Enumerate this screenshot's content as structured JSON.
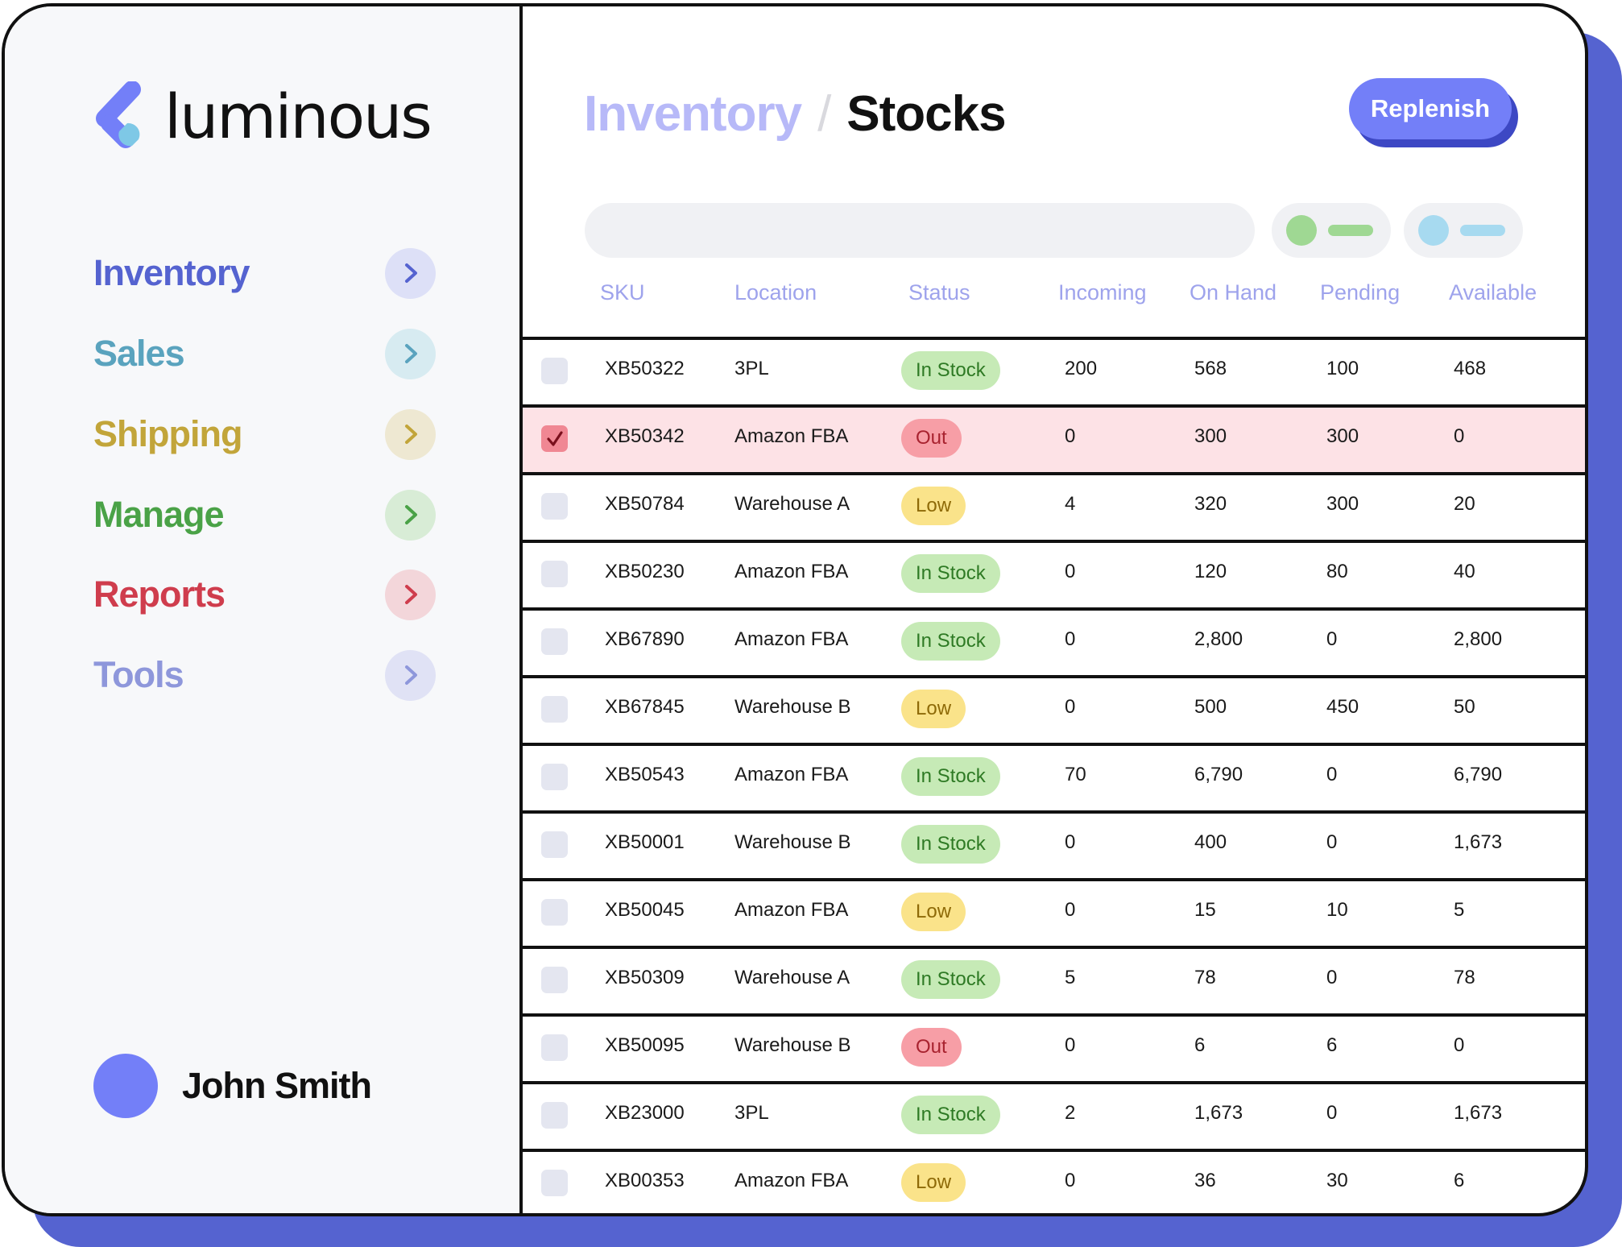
{
  "brand": {
    "name": "luminous"
  },
  "sidebar": {
    "items": [
      {
        "label": "Inventory",
        "color": "#5563d0",
        "chevron_bg": "#dde0f7",
        "chevron_color": "#5563d0",
        "icon": "chevron-right-icon"
      },
      {
        "label": "Sales",
        "color": "#5aa3be",
        "chevron_bg": "#d7ebf1",
        "chevron_color": "#5aa3be",
        "icon": "chevron-right-icon"
      },
      {
        "label": "Shipping",
        "color": "#c2a53a",
        "chevron_bg": "#eee8d2",
        "chevron_color": "#c2a53a",
        "icon": "chevron-right-icon"
      },
      {
        "label": "Manage",
        "color": "#4aa247",
        "chevron_bg": "#d8ecd6",
        "chevron_color": "#4aa247",
        "icon": "chevron-right-icon"
      },
      {
        "label": "Reports",
        "color": "#cf3d4d",
        "chevron_bg": "#f3d6da",
        "chevron_color": "#cf3d4d",
        "icon": "chevron-right-icon"
      },
      {
        "label": "Tools",
        "color": "#8e97db",
        "chevron_bg": "#e0e2f5",
        "chevron_color": "#8e97db",
        "icon": "chevron-right-icon"
      }
    ]
  },
  "user": {
    "name": "John Smith"
  },
  "header": {
    "breadcrumb_parent": "Inventory",
    "breadcrumb_separator": "/",
    "breadcrumb_current": "Stocks",
    "replenish_label": "Replenish"
  },
  "search": {
    "value": "",
    "placeholder": ""
  },
  "filters": [
    {
      "dot_color": "#9fd893",
      "bar_color": "#9fd893"
    },
    {
      "dot_color": "#a7daf0",
      "bar_color": "#a7daf0"
    }
  ],
  "table": {
    "columns": [
      "SKU",
      "Location",
      "Status",
      "Incoming",
      "On Hand",
      "Pending",
      "Available"
    ],
    "rows": [
      {
        "sku": "XB50322",
        "location": "3PL",
        "status": "In Stock",
        "status_type": "instock",
        "incoming": "200",
        "on_hand": "568",
        "pending": "100",
        "available": "468",
        "selected": false
      },
      {
        "sku": "XB50342",
        "location": "Amazon FBA",
        "status": "Out",
        "status_type": "out",
        "incoming": "0",
        "on_hand": "300",
        "pending": "300",
        "available": "0",
        "selected": true
      },
      {
        "sku": "XB50784",
        "location": "Warehouse A",
        "status": "Low",
        "status_type": "low",
        "incoming": "4",
        "on_hand": "320",
        "pending": "300",
        "available": "20",
        "selected": false
      },
      {
        "sku": "XB50230",
        "location": "Amazon FBA",
        "status": "In Stock",
        "status_type": "instock",
        "incoming": "0",
        "on_hand": "120",
        "pending": "80",
        "available": "40",
        "selected": false
      },
      {
        "sku": "XB67890",
        "location": "Amazon FBA",
        "status": "In Stock",
        "status_type": "instock",
        "incoming": "0",
        "on_hand": "2,800",
        "pending": "0",
        "available": "2,800",
        "selected": false
      },
      {
        "sku": "XB67845",
        "location": "Warehouse B",
        "status": "Low",
        "status_type": "low",
        "incoming": "0",
        "on_hand": "500",
        "pending": "450",
        "available": "50",
        "selected": false
      },
      {
        "sku": "XB50543",
        "location": "Amazon FBA",
        "status": "In Stock",
        "status_type": "instock",
        "incoming": "70",
        "on_hand": "6,790",
        "pending": "0",
        "available": "6,790",
        "selected": false
      },
      {
        "sku": "XB50001",
        "location": "Warehouse B",
        "status": "In Stock",
        "status_type": "instock",
        "incoming": "0",
        "on_hand": "400",
        "pending": "0",
        "available": "1,673",
        "selected": false
      },
      {
        "sku": "XB50045",
        "location": "Amazon FBA",
        "status": "Low",
        "status_type": "low",
        "incoming": "0",
        "on_hand": "15",
        "pending": "10",
        "available": "5",
        "selected": false
      },
      {
        "sku": "XB50309",
        "location": "Warehouse A",
        "status": "In Stock",
        "status_type": "instock",
        "incoming": "5",
        "on_hand": "78",
        "pending": "0",
        "available": "78",
        "selected": false
      },
      {
        "sku": "XB50095",
        "location": "Warehouse B",
        "status": "Out",
        "status_type": "out",
        "incoming": "0",
        "on_hand": "6",
        "pending": "6",
        "available": "0",
        "selected": false
      },
      {
        "sku": "XB23000",
        "location": "3PL",
        "status": "In Stock",
        "status_type": "instock",
        "incoming": "2",
        "on_hand": "1,673",
        "pending": "0",
        "available": "1,673",
        "selected": false
      },
      {
        "sku": "XB00353",
        "location": "Amazon FBA",
        "status": "Low",
        "status_type": "low",
        "incoming": "0",
        "on_hand": "36",
        "pending": "30",
        "available": "6",
        "selected": false
      }
    ]
  },
  "colors": {
    "accent": "#737ff8",
    "accent_shadow": "#3d48c4",
    "frame_shadow": "#5563d0",
    "selected_row": "#fde2e6"
  }
}
